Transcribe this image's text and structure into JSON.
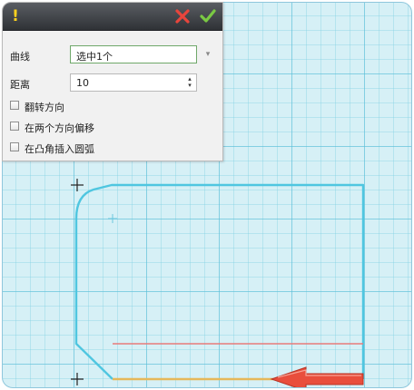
{
  "panel": {
    "curve_label": "曲线",
    "curve_value": "选中1个",
    "distance_label": "距离",
    "distance_value": "10",
    "options": [
      {
        "label": "翻转方向",
        "checked": false
      },
      {
        "label": "在两个方向偏移",
        "checked": false
      },
      {
        "label": "在凸角插入圆弧",
        "checked": false
      }
    ]
  },
  "icons": {
    "warning": "exclamation-icon",
    "cancel": "cancel-x-icon",
    "confirm": "checkmark-icon",
    "spinner": "spinner-arrows-icon",
    "dropdown": "chevron-down-icon"
  },
  "colors": {
    "curve": "#4fc6e0",
    "offset_line": "#e87a7a",
    "selected_edge": "#e6b85a",
    "arrow": "#e94e3c",
    "cancel": "#e8453c",
    "confirm": "#7ac943"
  }
}
